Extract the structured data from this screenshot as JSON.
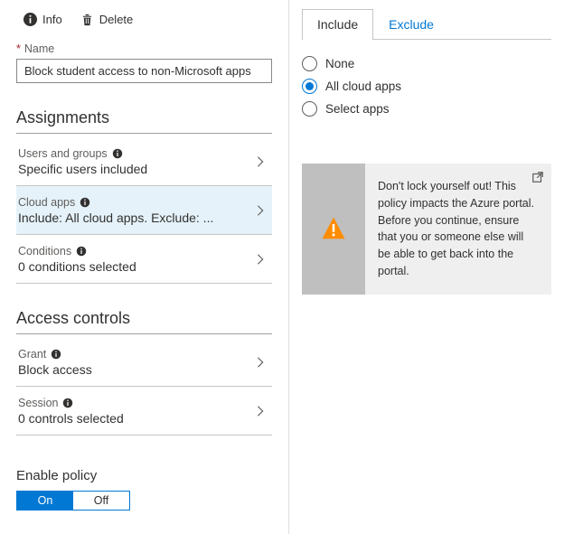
{
  "toolbar": {
    "info_label": "Info",
    "delete_label": "Delete"
  },
  "name_field": {
    "label": "Name",
    "value": "Block student access to non-Microsoft apps"
  },
  "sections": {
    "assignments": {
      "title": "Assignments",
      "items": [
        {
          "label": "Users and groups",
          "value": "Specific users included"
        },
        {
          "label": "Cloud apps",
          "value": "Include: All cloud apps. Exclude: ..."
        },
        {
          "label": "Conditions",
          "value": "0 conditions selected"
        }
      ]
    },
    "access_controls": {
      "title": "Access controls",
      "items": [
        {
          "label": "Grant",
          "value": "Block access"
        },
        {
          "label": "Session",
          "value": "0 controls selected"
        }
      ]
    }
  },
  "enable_policy": {
    "title": "Enable policy",
    "on_label": "On",
    "off_label": "Off",
    "state": "on"
  },
  "right": {
    "tabs": {
      "include": "Include",
      "exclude": "Exclude",
      "active": "include"
    },
    "radios": [
      {
        "label": "None",
        "checked": false
      },
      {
        "label": "All cloud apps",
        "checked": true
      },
      {
        "label": "Select apps",
        "checked": false
      }
    ],
    "warning": "Don't lock yourself out! This policy impacts the Azure portal. Before you continue, ensure that you or someone else will be able to get back into the portal."
  }
}
